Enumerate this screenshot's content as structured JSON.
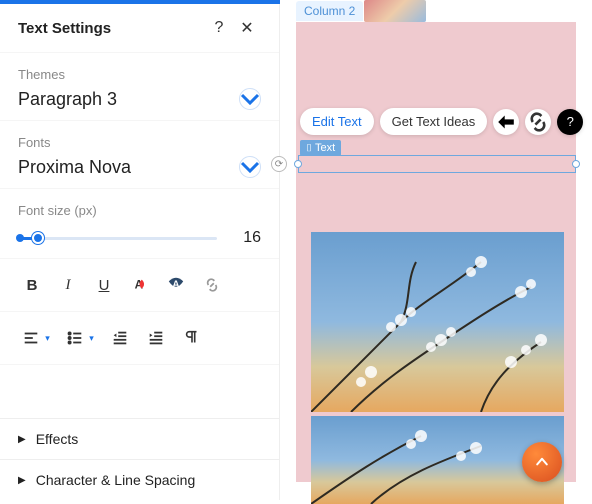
{
  "panel": {
    "title": "Text Settings",
    "help": "?",
    "close": "✕",
    "themes_label": "Themes",
    "themes_value": "Paragraph 3",
    "fonts_label": "Fonts",
    "fonts_value": "Proxima Nova",
    "fontsize_label": "Font size (px)",
    "fontsize_value": "16",
    "effects_label": "Effects",
    "spacing_label": "Character & Line Spacing"
  },
  "canvas": {
    "column_label": "Column 2",
    "edit_text": "Edit Text",
    "get_ideas": "Get Text Ideas",
    "element_tag": "Text"
  }
}
